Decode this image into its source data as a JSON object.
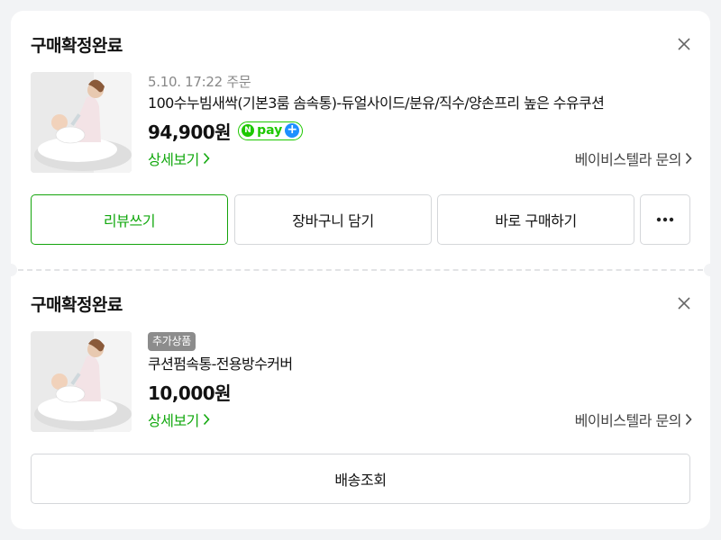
{
  "orders": [
    {
      "status": "구매확정완료",
      "date": "5.10. 17:22 주문",
      "name": "100수누빔새싹(기본3룸 솜속통)-듀얼사이드/분유/직수/양손프리 높은 수유쿠션",
      "price": "94,900원",
      "npay": "pay",
      "detail_label": "상세보기",
      "inquiry_label": "베이비스텔라 문의",
      "buttons": {
        "review": "리뷰쓰기",
        "cart": "장바구니 담기",
        "buy": "바로 구매하기"
      }
    },
    {
      "status": "구매확정완료",
      "badge": "추가상품",
      "name": "쿠션펌속통-전용방수커버",
      "price": "10,000원",
      "detail_label": "상세보기",
      "inquiry_label": "베이비스텔라 문의",
      "buttons": {
        "track": "배송조회"
      }
    }
  ],
  "colors": {
    "accent_green": "#12a80e",
    "npay_green": "#1ec800",
    "npay_plus_blue": "#1e90ff",
    "background": "#f2f3f5"
  },
  "icons": [
    "close-icon",
    "chevron-right-icon",
    "more-icon",
    "npay-logo"
  ]
}
